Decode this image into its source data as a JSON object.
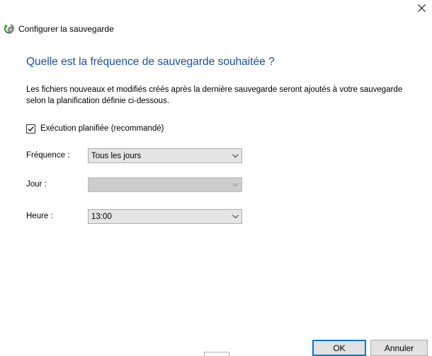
{
  "window": {
    "close_glyph": "✕",
    "title": "Configurer la sauvegarde",
    "icon": "backup-app-icon"
  },
  "main": {
    "heading": "Quelle est la fréquence de sauvegarde souhaitée ?",
    "description_line1": "Les fichiers nouveaux et modifiés créés après la dernière sauvegarde seront ajoutés à votre sauvegarde",
    "description_line2": "selon la planification définie ci-dessous."
  },
  "schedule": {
    "checkbox_label": "Exécution planifiée (recommandé)",
    "checked": true
  },
  "fields": {
    "frequency_label": "Fréquence :",
    "frequency_value": "Tous les jours",
    "day_label": "Jour :",
    "day_value": "",
    "time_label": "Heure :",
    "time_value": "13:00"
  },
  "footer": {
    "ok_label": "OK",
    "cancel_label": "Annuler"
  },
  "colors": {
    "heading": "#1a4ea1",
    "default_button_border": "#0078d7"
  }
}
